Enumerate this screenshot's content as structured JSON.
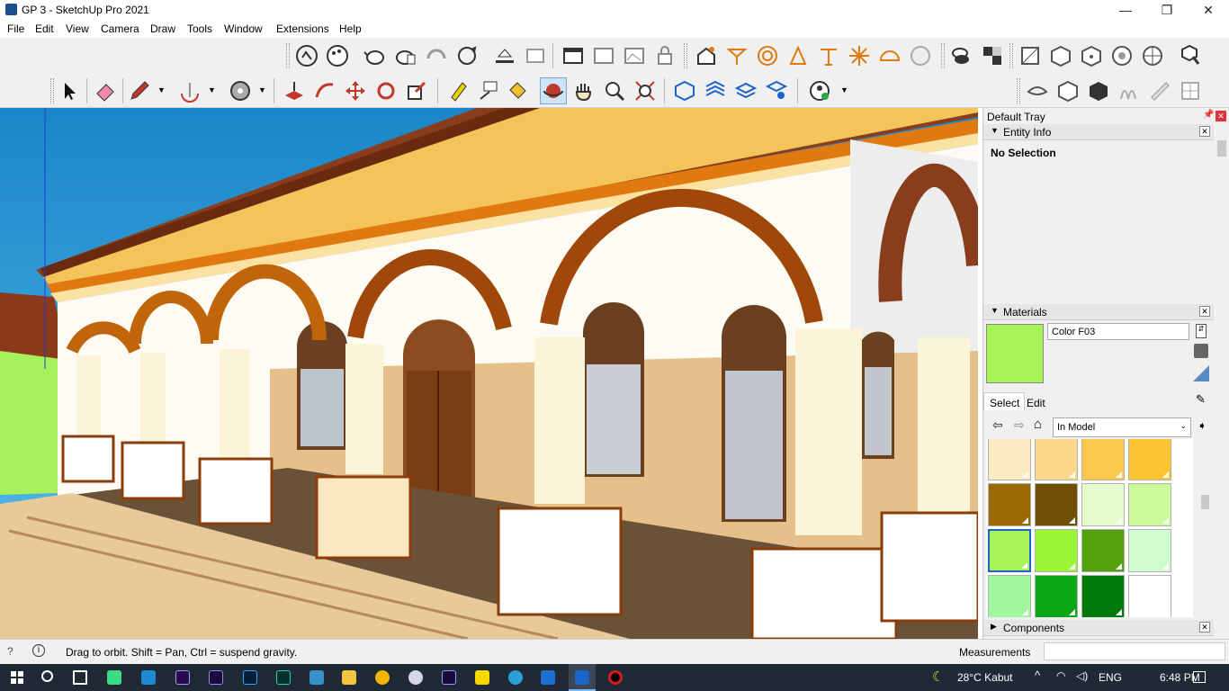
{
  "window": {
    "title": "GP 3 - SketchUp Pro 2021",
    "min": "—",
    "max": "❐",
    "close": "✕"
  },
  "menu": [
    "File",
    "Edit",
    "View",
    "Camera",
    "Draw",
    "Tools",
    "Window",
    "Extensions",
    "Help"
  ],
  "toolbar_top": [
    "getting-started",
    "color",
    "teapot-a",
    "teapot-b",
    "orbit-a",
    "rotate-view",
    "style-a",
    "style-b",
    "window-a",
    "window-b",
    "window-c",
    "window-d",
    "house-sun",
    "tripod",
    "circle-target",
    "cone",
    "pin",
    "star-burst",
    "dome",
    "cube-a",
    "group-a",
    "group-b",
    "box-a",
    "box-b",
    "box-c",
    "sphere",
    "ball",
    "cursor-cube"
  ],
  "toolbar_bottom": [
    "select",
    "eraser",
    "pencil",
    "arc",
    "shape",
    "push-pull",
    "follow-me",
    "move",
    "rotate",
    "scale",
    "tape-measure",
    "dimension",
    "paint-bucket",
    "orbit",
    "pan",
    "zoom",
    "zoom-extents",
    "warehouse-a",
    "warehouse-b",
    "warehouse-c",
    "warehouse-d",
    "profile",
    "section-a",
    "section-b",
    "section-c",
    "section-d",
    "section-e"
  ],
  "tray": {
    "title": "Default Tray",
    "entity_info": {
      "label": "Entity Info",
      "value": "No Selection"
    },
    "materials": {
      "label": "Materials",
      "name": "Color F03",
      "color": "#a8f55a",
      "tabs": [
        "Select",
        "Edit"
      ],
      "collection": "In Model",
      "swatches": [
        "#fcebc2",
        "#fcd98a",
        "#fcc94e",
        "#fcc430",
        "#9a6a00",
        "#6e4f05",
        "#e6fccd",
        "#ccfb9a",
        "#a8f55a",
        "#9cf536",
        "#52a00a",
        "#d0fcd0",
        "#a0f7a0",
        "#0aa814",
        "#007a0c",
        "#ffffff"
      ]
    },
    "components": {
      "label": "Components"
    }
  },
  "status": {
    "hint": "Drag to orbit. Shift = Pan, Ctrl = suspend gravity.",
    "measurements_label": "Measurements",
    "measurements_value": ""
  },
  "taskbar": {
    "weather": "28°C  Kabut",
    "lang": "ENG",
    "time": "6:48 PM",
    "apps": [
      "start",
      "search",
      "task-view",
      "android",
      "vscode",
      "premiere",
      "media-encoder",
      "photoshop",
      "audition",
      "sim",
      "explorer",
      "chrome",
      "paint",
      "after-effects",
      "sticky",
      "telegram",
      "store",
      "sketchup",
      "record"
    ]
  }
}
